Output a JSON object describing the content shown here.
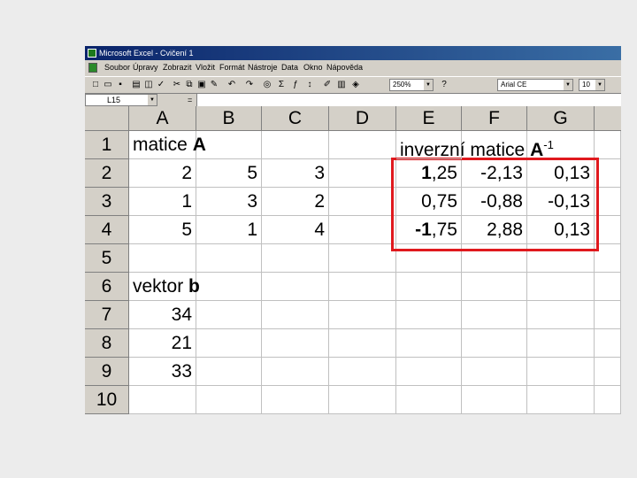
{
  "window": {
    "title": "Microsoft Excel - Cvičení 1"
  },
  "menu": [
    "Soubor",
    "Úpravy",
    "Zobrazit",
    "Vložit",
    "Formát",
    "Nástroje",
    "Data",
    "Okno",
    "Nápověda"
  ],
  "toolbar": {
    "zoom": "250%",
    "font": "Arial CE",
    "font_size": "10"
  },
  "formula_bar": {
    "name_box": "L15",
    "equals": "=",
    "content": ""
  },
  "columns": [
    "A",
    "B",
    "C",
    "D",
    "E",
    "F",
    "G"
  ],
  "rows": [
    "1",
    "2",
    "3",
    "4",
    "5",
    "6",
    "7",
    "8",
    "9",
    "10"
  ],
  "cells": {
    "A1": {
      "prefix": "matice ",
      "bold": "A"
    },
    "E1": {
      "prefix": "inverzní matice ",
      "bold": "A",
      "sup": "-1"
    },
    "A2": "2",
    "B2": "5",
    "C2": "3",
    "A3": "1",
    "B3": "3",
    "C3": "2",
    "A4": "5",
    "B4": "1",
    "C4": "4",
    "E2": {
      "bold": "1",
      "rest": ",25"
    },
    "F2": "-2,13",
    "G2": "0,13",
    "E3": "0,75",
    "F3": "-0,88",
    "G3": "-0,13",
    "E4": {
      "bold": "-1",
      "rest": ",75"
    },
    "F4": "2,88",
    "G4": "0,13",
    "A6": {
      "prefix": "vektor ",
      "bold": "b"
    },
    "A7": "34",
    "A8": "21",
    "A9": "33"
  },
  "highlight_color": "#e0191e"
}
